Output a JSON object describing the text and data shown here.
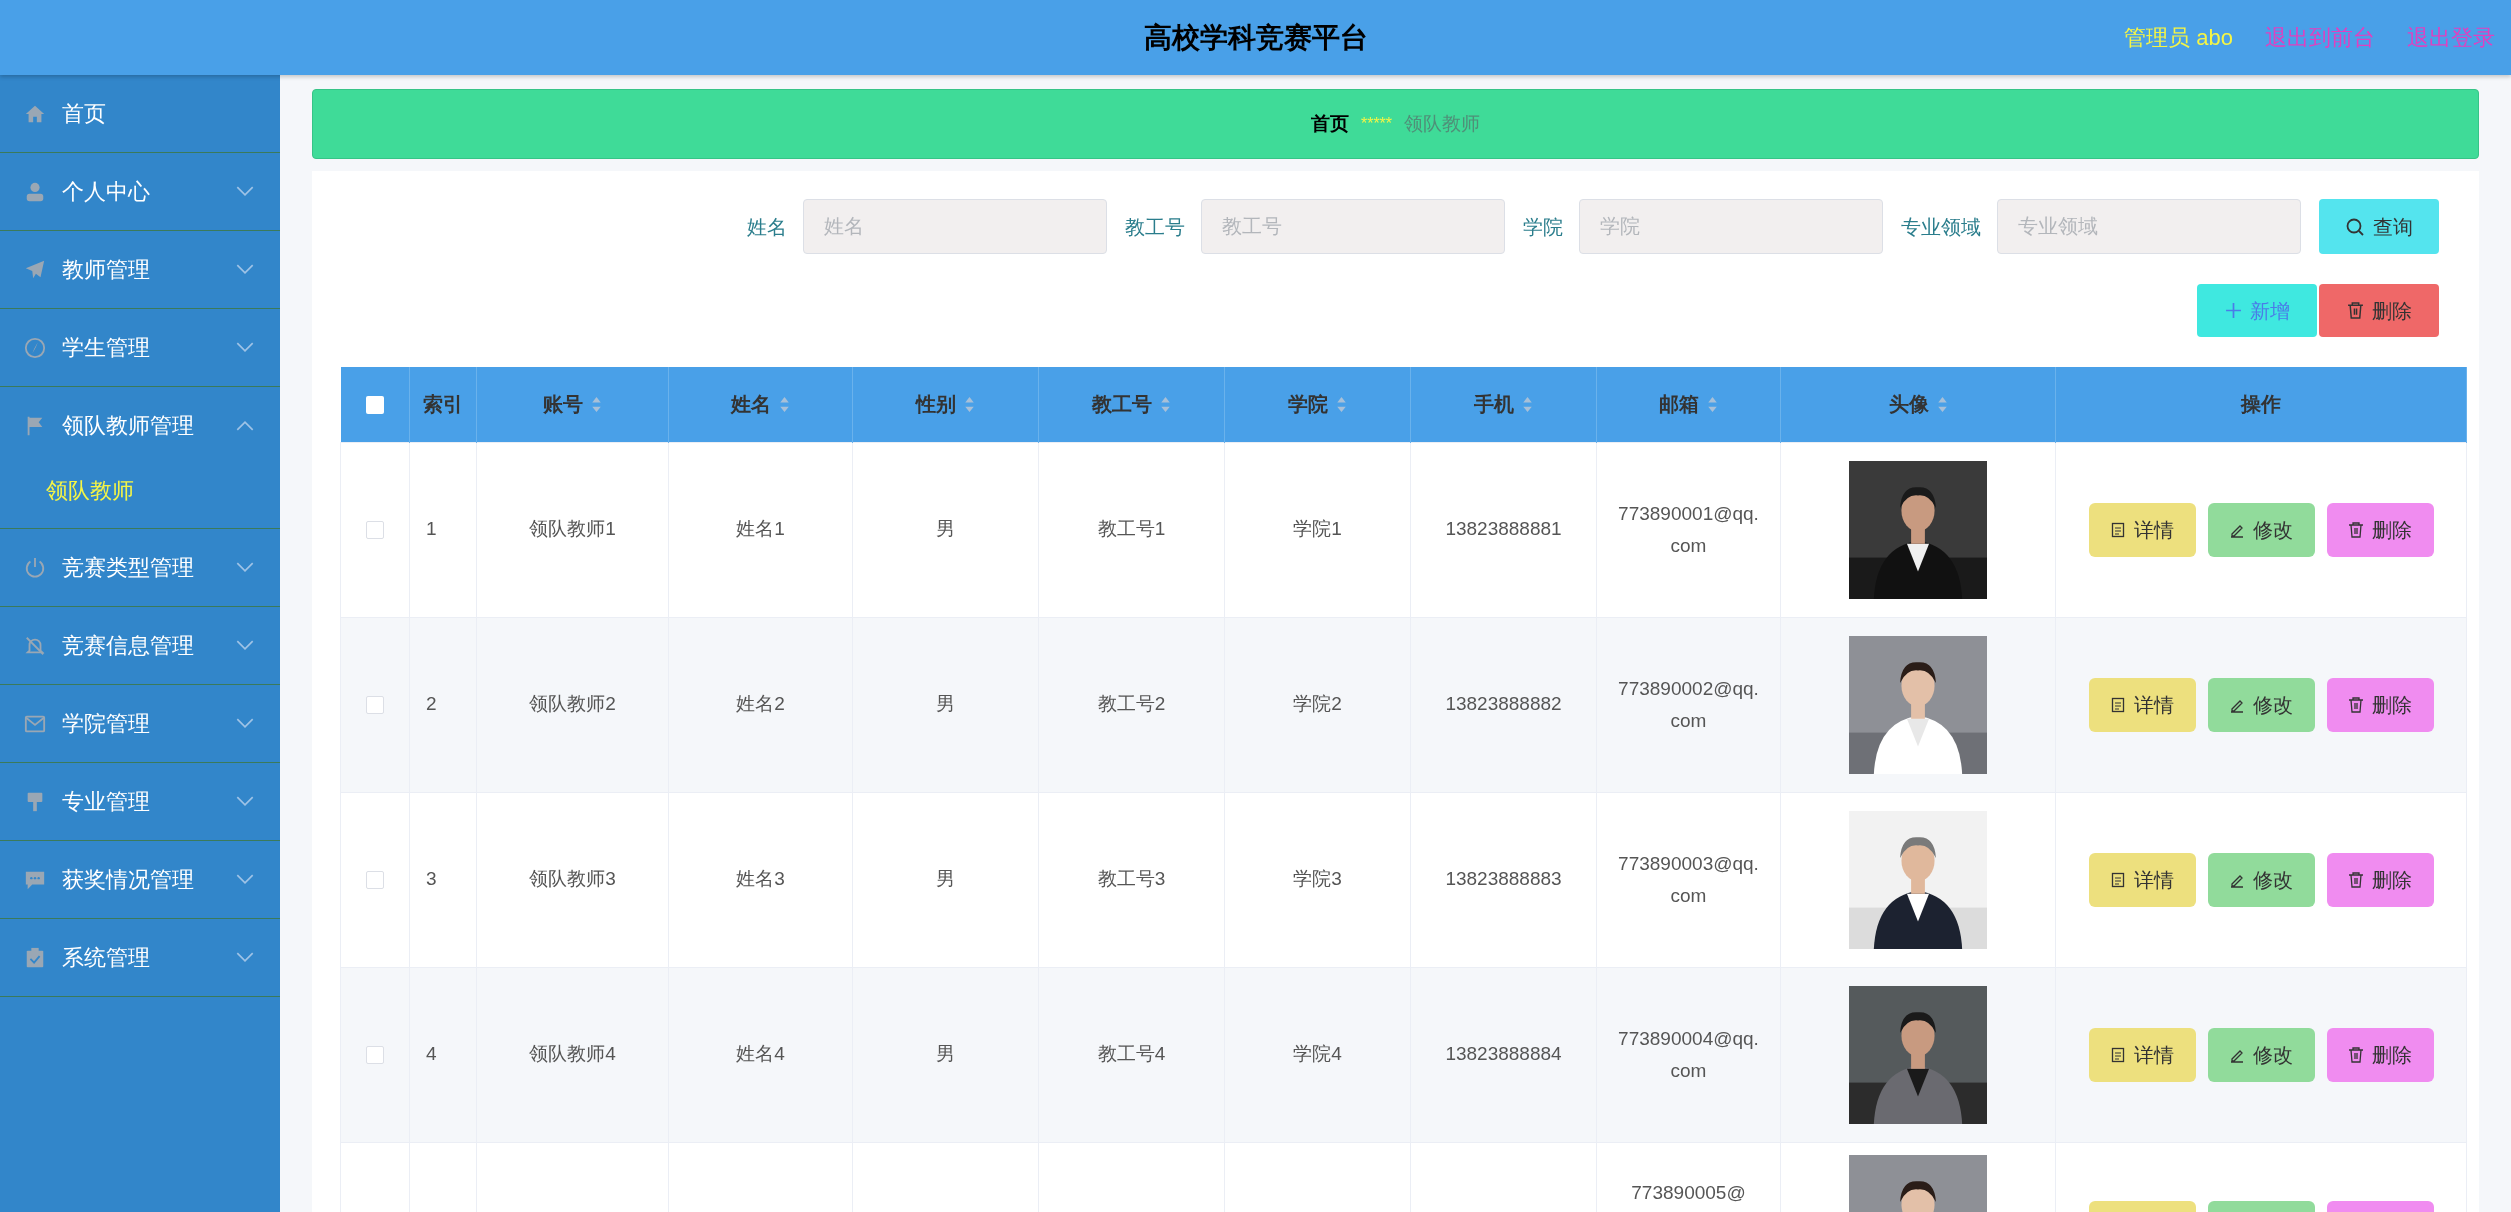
{
  "header": {
    "title": "高校学科竞赛平台",
    "user": "管理员 abo",
    "links": [
      "退出到前台",
      "退出登录"
    ]
  },
  "sidebar": {
    "items": [
      {
        "label": "首页",
        "has_arrow": false
      },
      {
        "label": "个人中心",
        "expanded": false,
        "has_arrow": true
      },
      {
        "label": "教师管理",
        "expanded": false,
        "has_arrow": true
      },
      {
        "label": "学生管理",
        "expanded": false,
        "has_arrow": true
      },
      {
        "label": "领队教师管理",
        "expanded": true,
        "has_arrow": true,
        "children": [
          {
            "label": "领队教师",
            "selected": true
          }
        ]
      },
      {
        "label": "竞赛类型管理",
        "expanded": false,
        "has_arrow": true
      },
      {
        "label": "竞赛信息管理",
        "expanded": false,
        "has_arrow": true
      },
      {
        "label": "学院管理",
        "expanded": false,
        "has_arrow": true
      },
      {
        "label": "专业管理",
        "expanded": false,
        "has_arrow": true
      },
      {
        "label": "获奖情况管理",
        "expanded": false,
        "has_arrow": true
      },
      {
        "label": "系统管理",
        "expanded": false,
        "has_arrow": true
      }
    ]
  },
  "breadcrumb": {
    "home": "首页",
    "separator": "*****",
    "current": "领队教师"
  },
  "search": {
    "fields": [
      {
        "label": "姓名",
        "placeholder": "姓名"
      },
      {
        "label": "教工号",
        "placeholder": "教工号"
      },
      {
        "label": "学院",
        "placeholder": "学院"
      },
      {
        "label": "专业领域",
        "placeholder": "专业领域"
      }
    ],
    "button": "查询"
  },
  "actions": [
    {
      "kind": "add",
      "label": "新增"
    },
    {
      "kind": "delete",
      "label": "删除"
    }
  ],
  "table": {
    "columns": [
      {
        "label": "索引",
        "sortable": false
      },
      {
        "label": "账号",
        "sortable": true
      },
      {
        "label": "姓名",
        "sortable": true
      },
      {
        "label": "性别",
        "sortable": true
      },
      {
        "label": "教工号",
        "sortable": true
      },
      {
        "label": "学院",
        "sortable": true
      },
      {
        "label": "手机",
        "sortable": true
      },
      {
        "label": "邮箱",
        "sortable": true
      },
      {
        "label": "头像",
        "sortable": true
      },
      {
        "label": "操作",
        "sortable": false
      }
    ],
    "header_checked": false,
    "rows": [
      {
        "checked": false,
        "cells": [
          "1",
          "领队教师1",
          "姓名1",
          "男",
          "教工号1",
          "学院1",
          "13823888881",
          "773890001@qq.com"
        ],
        "buttons": [
          "详情",
          "修改",
          "删除"
        ]
      },
      {
        "checked": false,
        "cells": [
          "2",
          "领队教师2",
          "姓名2",
          "男",
          "教工号2",
          "学院2",
          "13823888882",
          "773890002@qq.com"
        ],
        "buttons": [
          "详情",
          "修改",
          "删除"
        ]
      },
      {
        "checked": false,
        "cells": [
          "3",
          "领队教师3",
          "姓名3",
          "男",
          "教工号3",
          "学院3",
          "13823888883",
          "773890003@qq.com"
        ],
        "buttons": [
          "详情",
          "修改",
          "删除"
        ]
      },
      {
        "checked": false,
        "cells": [
          "4",
          "领队教师4",
          "姓名4",
          "男",
          "教工号4",
          "学院4",
          "13823888884",
          "773890004@qq.com"
        ],
        "buttons": [
          "详情",
          "修改",
          "删除"
        ]
      }
    ],
    "partial_row": {
      "email": "773890005@"
    }
  }
}
